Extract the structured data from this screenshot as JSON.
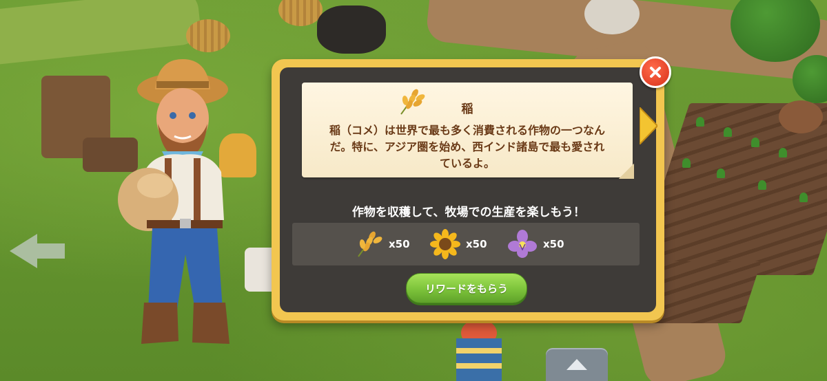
{
  "dialog": {
    "crop_name": "稲",
    "crop_icon": "rice-icon",
    "description_lines": [
      "稲（コメ）は世界で最も多く消費される作物の一つなん",
      "だ。特に、アジア圏を始め、西インド諸島で最も愛され",
      "ているよ。"
    ],
    "subtitle": "作物を収穫して、牧場での生産を楽しもう！",
    "rewards": [
      {
        "icon": "rice-icon",
        "quantity": "x50"
      },
      {
        "icon": "sunflower-icon",
        "quantity": "x50"
      },
      {
        "icon": "violet-flower-icon",
        "quantity": "x50"
      }
    ],
    "claim_button_label": "リワードをもらう",
    "close_icon": "close-icon",
    "next_icon": "next-arrow-icon"
  },
  "colors": {
    "frame": "#f2c650",
    "panel": "#3e3b38",
    "scroll": "#fff6e2",
    "text_brown": "#6a3a17",
    "button_green": "#7cc33a",
    "close_red": "#d8311a"
  }
}
